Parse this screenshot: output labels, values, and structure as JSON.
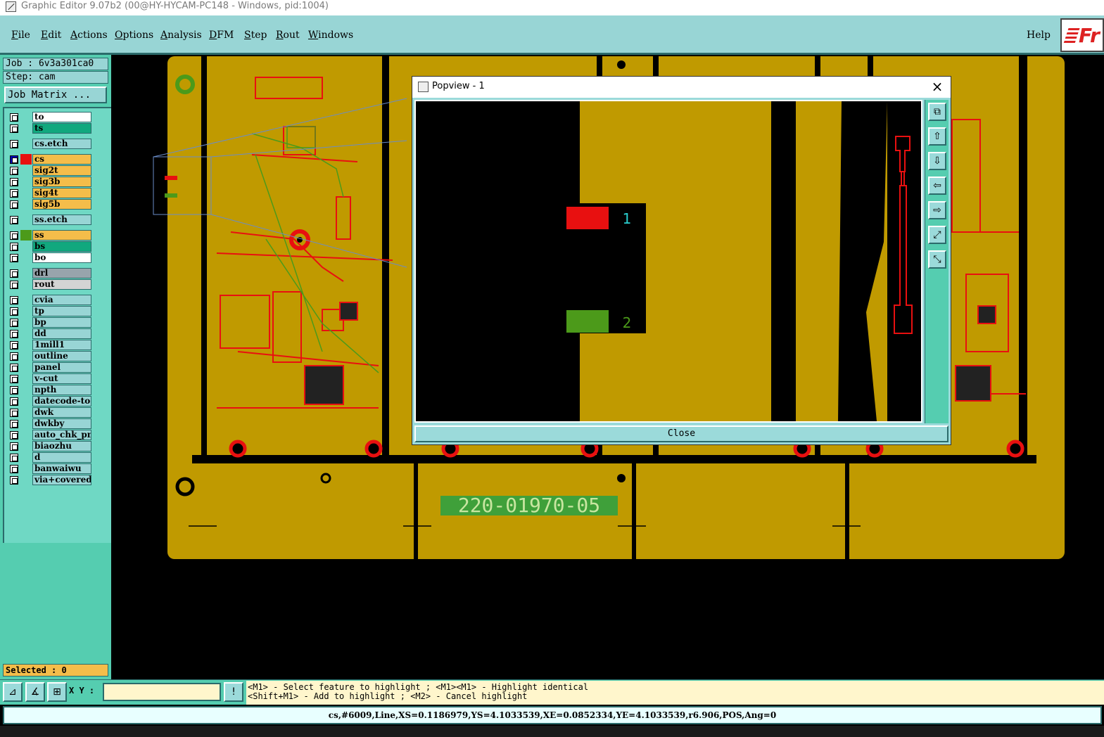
{
  "window": {
    "title": "Graphic Editor 9.07b2 (00@HY-HYCAM-PC148 - Windows, pid:1004)"
  },
  "menu": [
    {
      "label": "File"
    },
    {
      "label": "Edit"
    },
    {
      "label": "Actions"
    },
    {
      "label": "Options"
    },
    {
      "label": "Analysis"
    },
    {
      "label": "DFM"
    },
    {
      "label": "Step"
    },
    {
      "label": "Rout"
    },
    {
      "label": "Windows"
    },
    {
      "label": "Help"
    }
  ],
  "logo": {
    "text": "Fr"
  },
  "job": {
    "job_line": "Job : 6v3a301ca0",
    "step_line": "Step: cam",
    "matrix_button": "Job Matrix ..."
  },
  "layers": [
    {
      "name": "to",
      "color": "#ffffff"
    },
    {
      "name": "ts",
      "color": "#11a87e"
    },
    {
      "name": "cs.etch",
      "color": "#98d5d5"
    },
    {
      "name": "cs",
      "color": "#f4bd4a",
      "swatch": "#e81010",
      "active": true
    },
    {
      "name": "sig2t",
      "color": "#f4bd4a"
    },
    {
      "name": "sig3b",
      "color": "#f4bd4a"
    },
    {
      "name": "sig4t",
      "color": "#f4bd4a"
    },
    {
      "name": "sig5b",
      "color": "#f4bd4a"
    },
    {
      "name": "ss.etch",
      "color": "#98d5d5"
    },
    {
      "name": "ss",
      "color": "#f4bd4a",
      "swatch": "#4c9a1a"
    },
    {
      "name": "bs",
      "color": "#11a87e"
    },
    {
      "name": "bo",
      "color": "#ffffff"
    },
    {
      "name": "drl",
      "color": "#98a4ac"
    },
    {
      "name": "rout",
      "color": "#d4d4d4"
    },
    {
      "name": "cvia",
      "color": "#98d5d5"
    },
    {
      "name": "tp",
      "color": "#98d5d5"
    },
    {
      "name": "bp",
      "color": "#98d5d5"
    },
    {
      "name": "dd",
      "color": "#98d5d5"
    },
    {
      "name": "1mill1",
      "color": "#98d5d5"
    },
    {
      "name": "outline",
      "color": "#98d5d5"
    },
    {
      "name": "panel",
      "color": "#98d5d5"
    },
    {
      "name": "v-cut",
      "color": "#98d5d5"
    },
    {
      "name": "npth",
      "color": "#98d5d5"
    },
    {
      "name": "datecode-to",
      "color": "#98d5d5"
    },
    {
      "name": "dwk",
      "color": "#98d5d5"
    },
    {
      "name": "dwkby",
      "color": "#98d5d5"
    },
    {
      "name": "auto_chk_pn.",
      "color": "#98d5d5"
    },
    {
      "name": "biaozhu",
      "color": "#98d5d5"
    },
    {
      "name": "d",
      "color": "#98d5d5"
    },
    {
      "name": "banwaiwu",
      "color": "#98d5d5"
    },
    {
      "name": "via+covered",
      "color": "#98d5d5"
    }
  ],
  "selected": {
    "text": "Selected : 0"
  },
  "canvas": {
    "board_label": "220-01970-05"
  },
  "popview": {
    "title": "Popview - 1",
    "close_label": "Close",
    "pad_top_label": "1",
    "pad_bottom_label": "2"
  },
  "status": {
    "xy_label": "X Y :",
    "xy_value": "",
    "hint_line1": "<M1> - Select feature to highlight ; <M1><M1> - Highlight identical",
    "hint_line2": "<Shift+M1> - Add to highlight ; <M2> - Cancel highlight",
    "feature_info": "cs,#6009,Line,XS=0.1186979,YS=4.1033539,XE=0.0852334,YE=4.1033539,r6.906,POS,Ang=0"
  },
  "colors": {
    "board": "#c09a00",
    "copper": "#e81010",
    "silk": "#4c9a1a",
    "panel_bg": "#55cdb0",
    "menu_bg": "#98d5d5"
  }
}
